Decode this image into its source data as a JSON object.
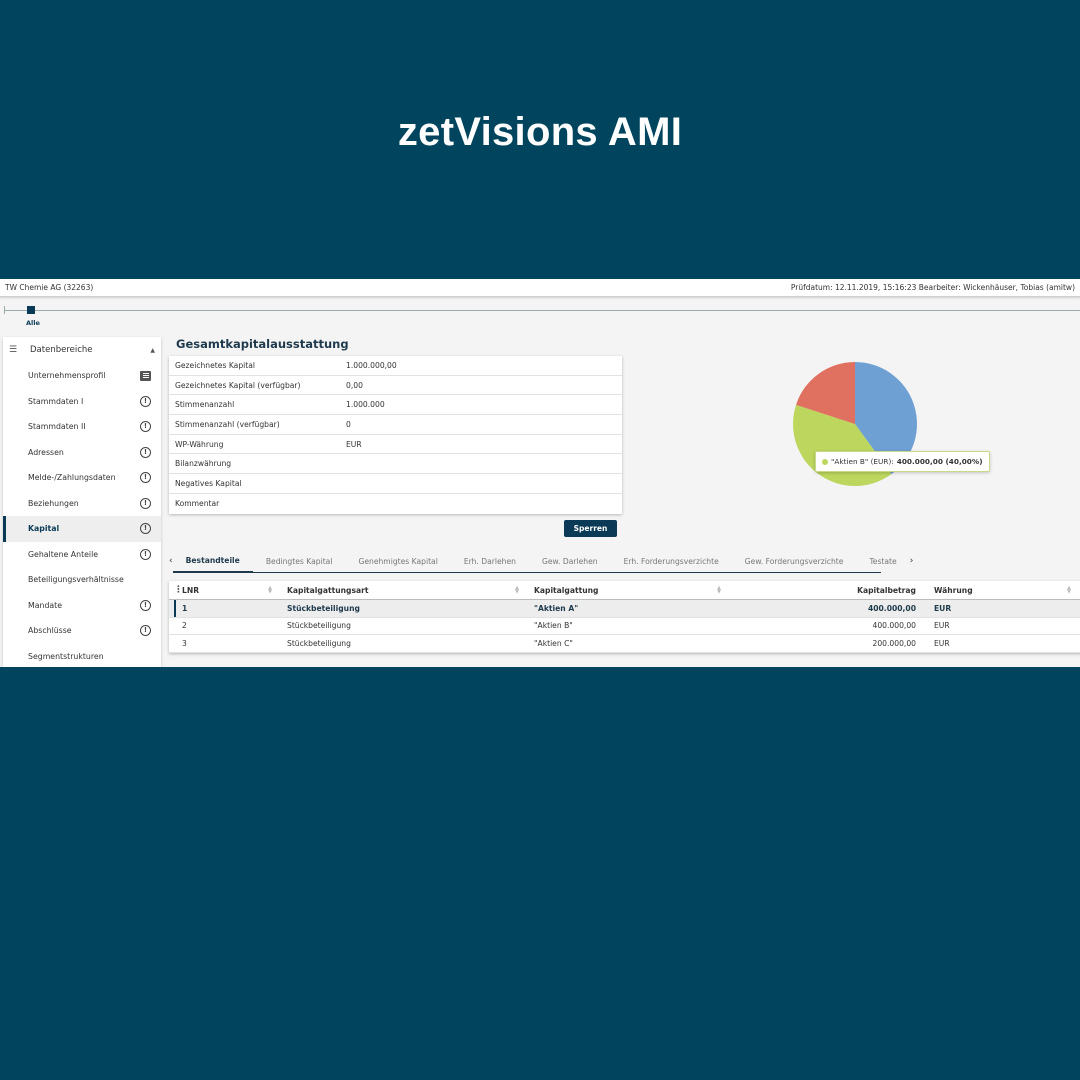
{
  "hero": {
    "title": "zetVisions AMI"
  },
  "topbar": {
    "company": "TW Chemie AG (32263)",
    "info": "Prüfdatum: 12.11.2019, 15:16:23 Bearbeiter: Wickenhäuser, Tobias (amitw)"
  },
  "timeline": {
    "label": "Alle"
  },
  "sidebar": {
    "title": "Datenbereiche",
    "items": [
      {
        "label": "Unternehmensprofil",
        "icon": "book-icon"
      },
      {
        "label": "Stammdaten I",
        "icon": "alert-icon"
      },
      {
        "label": "Stammdaten II",
        "icon": "alert-icon"
      },
      {
        "label": "Adressen",
        "icon": "alert-icon"
      },
      {
        "label": "Melde-/Zahlungsdaten",
        "icon": "alert-icon"
      },
      {
        "label": "Beziehungen",
        "icon": "alert-icon"
      },
      {
        "label": "Kapital",
        "icon": "alert-icon",
        "active": true
      },
      {
        "label": "Gehaltene Anteile",
        "icon": "alert-icon"
      },
      {
        "label": "Beteiligungsverhältnisse",
        "icon": ""
      },
      {
        "label": "Mandate",
        "icon": "alert-icon"
      },
      {
        "label": "Abschlüsse",
        "icon": "alert-icon"
      },
      {
        "label": "Segmentstrukturen",
        "icon": ""
      }
    ],
    "status_symbol": "!"
  },
  "overview": {
    "title": "Gesamtkapitalausstattung",
    "rows": [
      {
        "key": "Gezeichnetes Kapital",
        "value": "1.000.000,00"
      },
      {
        "key": "Gezeichnetes Kapital (verfügbar)",
        "value": "0,00"
      },
      {
        "key": "Stimmenanzahl",
        "value": "1.000.000"
      },
      {
        "key": "Stimmenanzahl (verfügbar)",
        "value": "0"
      },
      {
        "key": "WP-Währung",
        "value": "EUR"
      },
      {
        "key": "Bilanzwährung",
        "value": ""
      },
      {
        "key": "Negatives Kapital",
        "value": ""
      },
      {
        "key": "Kommentar",
        "value": ""
      }
    ],
    "lock_button": "Sperren"
  },
  "chart_data": {
    "type": "pie",
    "slices": [
      {
        "label": "\"Aktien A\"",
        "value": 400000,
        "color": "#6fa0d4"
      },
      {
        "label": "\"Aktien B\"",
        "value": 400000,
        "color": "#bcd65e"
      },
      {
        "label": "\"Aktien C\"",
        "value": 200000,
        "color": "#e0705f"
      }
    ],
    "tooltip": {
      "label": "\"Aktien B\" (EUR):",
      "value": "400.000,00 (40,00%)",
      "color": "#bcd65e"
    }
  },
  "tabs": {
    "prev": "‹",
    "next": "›",
    "items": [
      {
        "label": "Bestandteile",
        "active": true
      },
      {
        "label": "Bedingtes Kapital"
      },
      {
        "label": "Genehmigtes Kapital"
      },
      {
        "label": "Erh. Darlehen"
      },
      {
        "label": "Gew. Darlehen"
      },
      {
        "label": "Erh. Forderungsverzichte"
      },
      {
        "label": "Gew. Forderungsverzichte"
      },
      {
        "label": "Testate"
      }
    ]
  },
  "grid": {
    "columns": [
      "LNR",
      "Kapitalgattungsart",
      "Kapitalgattung",
      "Kapitalbetrag",
      "Währung"
    ],
    "rows": [
      {
        "lnr": "1",
        "art": "Stückbeteiligung",
        "gattung": "\"Aktien A\"",
        "betrag": "400.000,00",
        "waehrung": "EUR",
        "selected": true
      },
      {
        "lnr": "2",
        "art": "Stückbeteiligung",
        "gattung": "\"Aktien B\"",
        "betrag": "400.000,00",
        "waehrung": "EUR"
      },
      {
        "lnr": "3",
        "art": "Stückbeteiligung",
        "gattung": "\"Aktien C\"",
        "betrag": "200.000,00",
        "waehrung": "EUR"
      }
    ]
  }
}
